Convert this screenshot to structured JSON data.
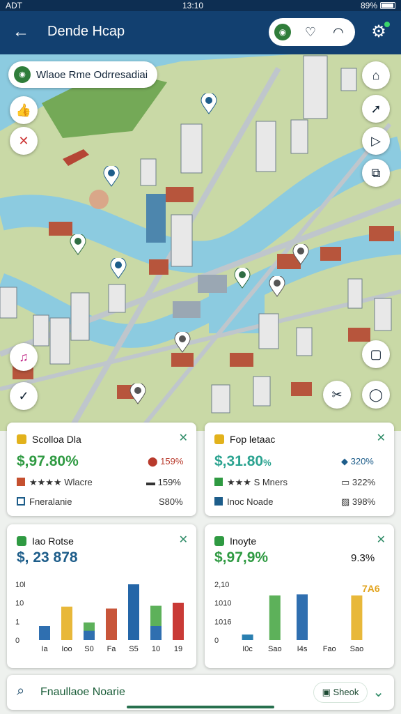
{
  "status": {
    "carrier": "ADT",
    "time": "13:10",
    "battery": "89%"
  },
  "header": {
    "title": "Dende Hcap",
    "logo_text": "◉"
  },
  "map": {
    "search_chip_text": "Wlaoe Rme Odrresadiai",
    "colors": {
      "water": "#8ccbe0",
      "land": "#c9d9a6",
      "park": "#74a957",
      "road": "#bfc6cc"
    }
  },
  "cards": {
    "c1": {
      "title": "Scolloa Dla",
      "value": "$,97.80%",
      "rows": [
        {
          "label": "★★★★ Wlacre",
          "value": "159%"
        },
        {
          "label": "Fneralanie",
          "value": "S80%"
        }
      ],
      "top_right": "159%",
      "colors": {
        "value": "#2f9a42",
        "accent": "#e2b21c"
      }
    },
    "c2": {
      "title": "Fop letaac",
      "value": "$,31.80",
      "value_suffix": "%",
      "rows": [
        {
          "label": "★★★ S Mners",
          "value": "322%"
        },
        {
          "label": "Inoc Noade",
          "value": "398%"
        }
      ],
      "top_right": "320%",
      "colors": {
        "value": "#2ba390"
      }
    },
    "c3": {
      "title": "Iao Rotse",
      "value": "$, 23 878",
      "chart_data": {
        "type": "bar",
        "categories": [
          "Ia",
          "Ioo",
          "S0",
          "Fa",
          "S5",
          "10",
          "19"
        ],
        "yticks": [
          "10l",
          "10",
          "1",
          "0"
        ],
        "series": [
          {
            "name": "",
            "values": [
              3,
              7.2,
              3.8,
              6.8,
              12,
              7.4,
              8
            ]
          },
          {
            "name": "",
            "values": [
              0,
              0,
              2,
              0,
              0,
              3,
              0
            ]
          }
        ]
      }
    },
    "c4": {
      "title": "Inoyte",
      "value": "$,97,9%",
      "right_value": "9.3%",
      "annot": "7A6",
      "chart_data": {
        "type": "bar",
        "categories": [
          "I0c",
          "Sao",
          "I4s",
          "Fao",
          "Sao"
        ],
        "yticks": [
          "2,10",
          "1010",
          "1016",
          "0"
        ],
        "values": [
          1,
          8,
          8.2,
          0,
          8
        ]
      }
    }
  },
  "bottom": {
    "text": "Fnaullaoe Noarie",
    "check_label": "Sheok"
  }
}
